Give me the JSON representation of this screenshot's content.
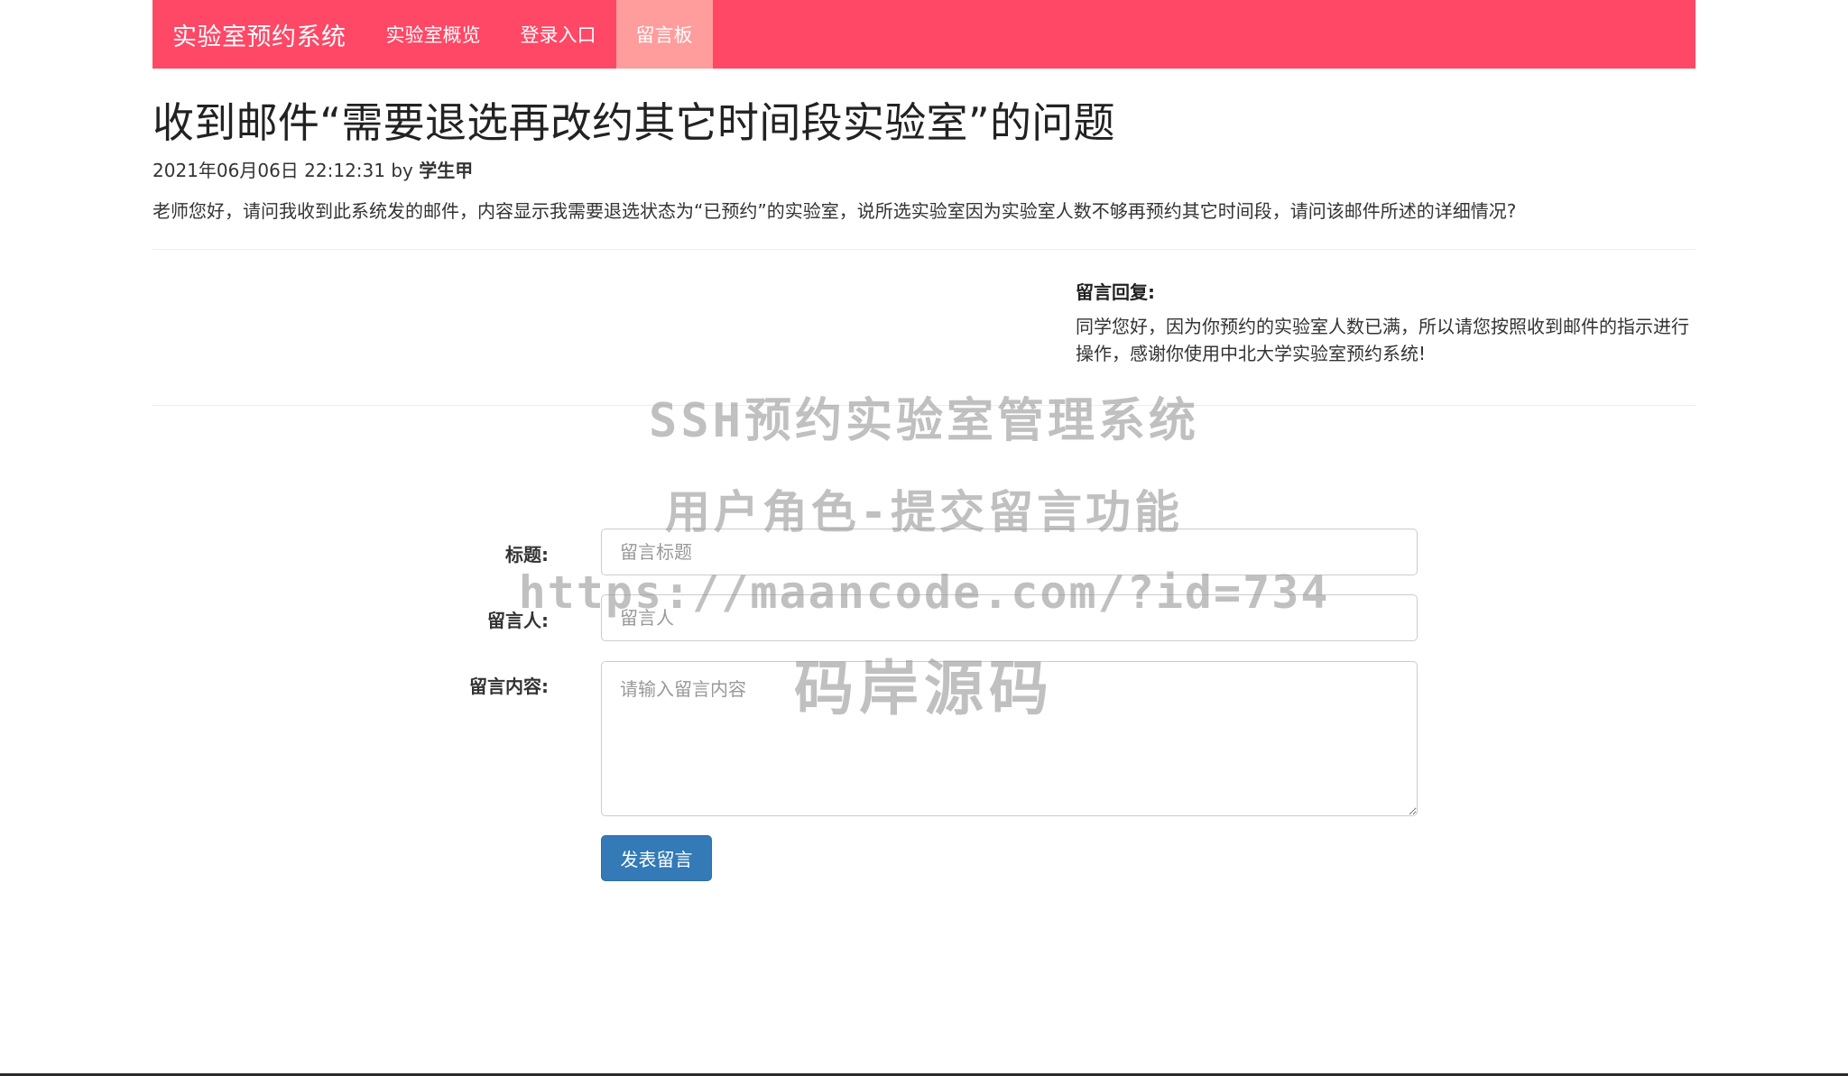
{
  "navbar": {
    "brand": "实验室预约系统",
    "items": [
      {
        "label": "实验室概览",
        "active": false
      },
      {
        "label": "登录入口",
        "active": false
      },
      {
        "label": "留言板",
        "active": true
      }
    ],
    "color": "#ff4766",
    "active_color": "#ff9c9c"
  },
  "post": {
    "title": "收到邮件“需要退选再改约其它时间段实验室”的问题",
    "datetime": "2021年06月06日 22:12:31",
    "by": "by",
    "author": "学生甲",
    "content": "老师您好，请问我收到此系统发的邮件，内容显示我需要退选状态为“已预约”的实验室，说所选实验室因为实验室人数不够再预约其它时间段，请问该邮件所述的详细情况?"
  },
  "reply": {
    "label": "留言回复:",
    "text": "同学您好，因为你预约的实验室人数已满，所以请您按照收到邮件的指示进行操作，感谢你使用中北大学实验室预约系统!"
  },
  "watermark": {
    "line1": "SSH预约实验室管理系统",
    "line2": "用户角色-提交留言功能",
    "line3": "https://maancode.com/?id=734",
    "line4": "码岸源码"
  },
  "form": {
    "title_label": "标题:",
    "title_placeholder": "留言标题",
    "author_label": "留言人:",
    "author_placeholder": "留言人",
    "content_label": "留言内容:",
    "content_placeholder": "请输入留言内容",
    "submit_label": "发表留言",
    "submit_color": "#337ab7"
  }
}
